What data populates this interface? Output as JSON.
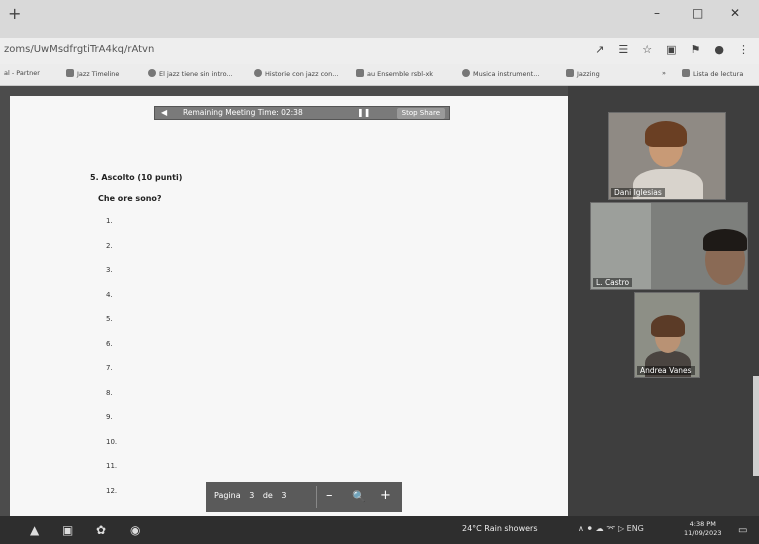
{
  "browser": {
    "new_tab_glyph": "+",
    "url": "zoms/UwMsdfrgtiTrA4kq/rAtvn",
    "window_controls": [
      "–",
      "□",
      "✕"
    ],
    "address_icons": [
      "↗",
      "☰",
      "☆",
      "▣",
      "⚑",
      "●",
      "⋮"
    ],
    "bookmarks": [
      {
        "label": "al - Partner",
        "icon": "bookmark-icon"
      },
      {
        "label": "Jazz Timeline",
        "icon": "grid-icon"
      },
      {
        "label": "El jazz tiene sin intro...",
        "icon": "globe-icon"
      },
      {
        "label": "Historie con jazz con...",
        "icon": "g-icon"
      },
      {
        "label": "au Ensemble rsbl-xk",
        "icon": "bird-icon"
      },
      {
        "label": "Musica instrument...",
        "icon": "globe-icon"
      },
      {
        "label": "Jazzing",
        "icon": "doc-icon"
      },
      {
        "label": "Lista de lectura",
        "icon": "reading-list-icon"
      }
    ],
    "bookmarks_more": "»"
  },
  "meeting": {
    "share_bar": {
      "timer_text": "Remaining Meeting Time: 02:38",
      "stop_share_label": "Stop Share"
    },
    "document": {
      "title": "5. Ascolto (10 punti)",
      "question": "Che ore sono?",
      "items": [
        "1.",
        "2.",
        "3.",
        "4.",
        "5.",
        "6.",
        "7.",
        "8.",
        "9.",
        "10.",
        "11.",
        "12."
      ]
    },
    "pdf_toolbar": {
      "page_label": "Pagina",
      "current_page": "3",
      "of_label": "de",
      "total_pages": "3",
      "zoom_out": "–",
      "zoom_icon": "🔍",
      "zoom_in": "+"
    },
    "participants": [
      {
        "name": "Dani Iglesias"
      },
      {
        "name": "L. Castro"
      },
      {
        "name": "Andrea Vanes"
      }
    ]
  },
  "taskbar": {
    "weather": "24°C  Rain showers",
    "tray": "∧  ⚫  ☁  ⌤  ▷  ENG",
    "time": "4:38 PM",
    "date": "11/09/2023"
  },
  "colors": {
    "meeting_bg": "#4c4c4c",
    "doc_bg": "#f7f7f7",
    "taskbar_bg": "#2e2e2e"
  }
}
